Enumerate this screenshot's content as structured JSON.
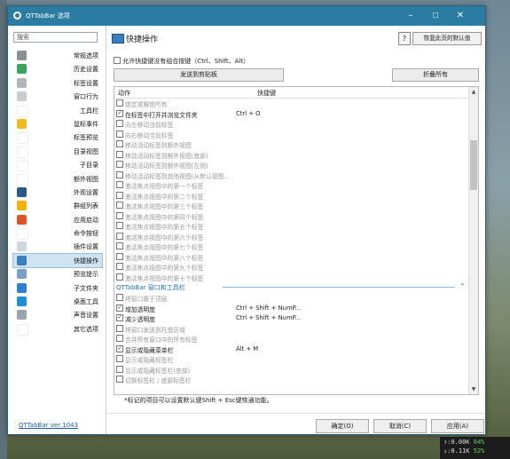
{
  "window": {
    "title": "QTTabBar 选项",
    "minimize": "–",
    "maximize": "☐",
    "close": "✕"
  },
  "sidebar": {
    "search_placeholder": "搜索",
    "items": [
      {
        "label": "常规选项",
        "icon": "gear-icon",
        "color": "#8a8f96"
      },
      {
        "label": "历史设置",
        "icon": "clock-icon",
        "color": "#3aa55a"
      },
      {
        "label": "标签设置",
        "icon": "tab-icon",
        "color": "#b0b4ba"
      },
      {
        "label": "窗口行为",
        "icon": "window-icon",
        "color": "#c9ccd1"
      },
      {
        "label": "工具栏",
        "icon": "toolbar-icon",
        "color": "#ffffff"
      },
      {
        "label": "鼠标事件",
        "icon": "lightning-icon",
        "color": "#f3b81b"
      },
      {
        "label": "标签预览",
        "icon": "preview-icon",
        "color": "#ffffff"
      },
      {
        "label": "目录视图",
        "icon": "folder-view-icon",
        "color": "#ffffff"
      },
      {
        "label": "子目录",
        "icon": "subfolder-icon",
        "color": "#ffffff"
      },
      {
        "label": "额外视图",
        "icon": "extra-view-icon",
        "color": "#ffffff"
      },
      {
        "label": "外观设置",
        "icon": "eye-icon",
        "color": "#2a5a8a"
      },
      {
        "label": "群组列表",
        "icon": "star-icon",
        "color": "#f4b400"
      },
      {
        "label": "应用启动",
        "icon": "app-icon",
        "color": "#e0542a"
      },
      {
        "label": "命令按钮",
        "icon": "command-icon",
        "color": "#ffffff"
      },
      {
        "label": "插件设置",
        "icon": "plugin-icon",
        "color": "#cfd6dd"
      },
      {
        "label": "快捷操作",
        "icon": "keyboard-icon",
        "color": "#3a7fc0",
        "selected": true
      },
      {
        "label": "预览提示",
        "icon": "tooltip-icon",
        "color": "#7aa0c8"
      },
      {
        "label": "子文件夹",
        "icon": "download-icon",
        "color": "#2f7fd0"
      },
      {
        "label": "桌面工具",
        "icon": "desktop-icon",
        "color": "#1e8fd6"
      },
      {
        "label": "声音设置",
        "icon": "disc-icon",
        "color": "#9aa4ae"
      },
      {
        "label": "其它选项",
        "icon": "misc-icon",
        "color": "#ffffff"
      }
    ],
    "version": "QTTabBar ver 1043"
  },
  "content": {
    "title": "快捷操作",
    "help": "?",
    "restore": "恢复此页的默认值",
    "allow_label": "允许快捷键没有组合按键（Ctrl、Shift、Alt）",
    "send_button": "发送到剪贴板",
    "fold_button": "折叠所有",
    "columns": {
      "action": "动作",
      "hotkey": "快捷键"
    },
    "rows_1": [
      {
        "name": "锁定或解锁所有",
        "key": "",
        "checked": false,
        "disabled": true
      },
      {
        "name": "在标签中打开并浏览文件夹",
        "key": "Ctrl + O",
        "checked": true,
        "disabled": false
      },
      {
        "name": "向左移动当前标签",
        "key": "",
        "checked": false,
        "disabled": true
      },
      {
        "name": "向右移动当前标签",
        "key": "",
        "checked": false,
        "disabled": true
      },
      {
        "name": "移动活动标签到额外视图",
        "key": "",
        "checked": false,
        "disabled": true
      },
      {
        "name": "移动活动标签到额外视图(底部)",
        "key": "",
        "checked": false,
        "disabled": true
      },
      {
        "name": "移动活动标签到额外视图(左侧)",
        "key": "",
        "checked": false,
        "disabled": true
      },
      {
        "name": "移动活动标签到其他视图(从默认视图...",
        "key": "",
        "checked": false,
        "disabled": true
      },
      {
        "name": "激活焦点视图中的第一个标签",
        "key": "",
        "checked": false,
        "disabled": true
      },
      {
        "name": "激活焦点视图中的第二个标签",
        "key": "",
        "checked": false,
        "disabled": true
      },
      {
        "name": "激活焦点视图中的第三个标签",
        "key": "",
        "checked": false,
        "disabled": true
      },
      {
        "name": "激活焦点视图中的第四个标签",
        "key": "",
        "checked": false,
        "disabled": true
      },
      {
        "name": "激活焦点视图中的第五个标签",
        "key": "",
        "checked": false,
        "disabled": true
      },
      {
        "name": "激活焦点视图中的第六个标签",
        "key": "",
        "checked": false,
        "disabled": true
      },
      {
        "name": "激活焦点视图中的第七个标签",
        "key": "",
        "checked": false,
        "disabled": true
      },
      {
        "name": "激活焦点视图中的第八个标签",
        "key": "",
        "checked": false,
        "disabled": true
      },
      {
        "name": "激活焦点视图中的第九个标签",
        "key": "",
        "checked": false,
        "disabled": true
      },
      {
        "name": "激活焦点视图中的第十个标签",
        "key": "",
        "checked": false,
        "disabled": true
      }
    ],
    "group": {
      "title": "QTTabBar 窗口和工具栏",
      "chevron": "⌃"
    },
    "rows_2": [
      {
        "name": "将窗口置于顶层",
        "key": "",
        "checked": false,
        "disabled": true
      },
      {
        "name": "增加透明度",
        "key": "Ctrl + Shift + NumP...",
        "checked": true,
        "disabled": false
      },
      {
        "name": "减少透明度",
        "key": "Ctrl + Shift + NumP...",
        "checked": true,
        "disabled": false
      },
      {
        "name": "将窗口发送到托盘区域",
        "key": "",
        "checked": false,
        "disabled": true
      },
      {
        "name": "合并所有窗口中的所有标签",
        "key": "",
        "checked": false,
        "disabled": true
      },
      {
        "name": "显示或隐藏菜单栏",
        "key": "Alt + M",
        "checked": true,
        "disabled": false
      },
      {
        "name": "显示或隐藏标签栏",
        "key": "",
        "checked": false,
        "disabled": true
      },
      {
        "name": "显示或隐藏标签栏(底部)",
        "key": "",
        "checked": false,
        "disabled": true
      },
      {
        "name": "切换标签栏 / 底部标签栏",
        "key": "",
        "checked": false,
        "disabled": true
      }
    ],
    "footnote": "*标记的项目可以设置默认键Shift + Esc键恢通功能。",
    "ok": "确定(O)",
    "cancel": "取消(C)",
    "apply": "应用(A)"
  },
  "tray": {
    "line1": "↑:0.00K",
    "pct1": "04%",
    "line2": "↓:0.11K",
    "pct2": "52%"
  }
}
